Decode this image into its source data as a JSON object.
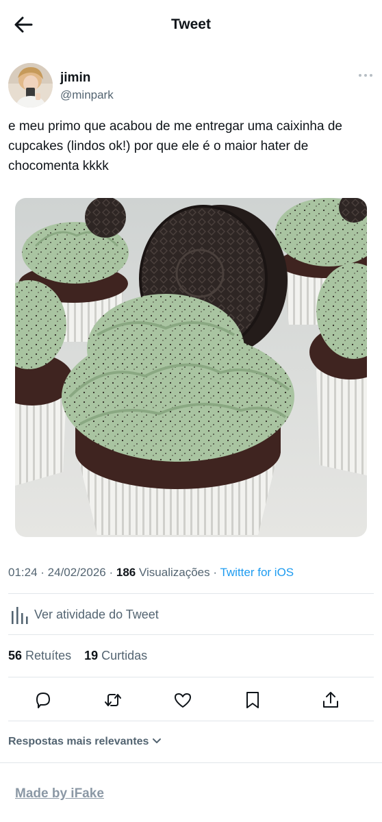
{
  "header": {
    "title": "Tweet",
    "back_icon": "arrow-left-icon"
  },
  "tweet": {
    "author": {
      "name": "jimin",
      "handle": "@minpark"
    },
    "text": "e meu primo que acabou de me entregar uma caixinha de cupcakes (lindos ok!) por que ele é o maior hater de chocomenta kkkk",
    "image_subject": "mint chocolate cupcakes with oreo cookies",
    "meta": {
      "time": "01:24",
      "date": "24/02/2026",
      "views_count": "186",
      "views_label": "Visualizações",
      "source": "Twitter for iOS"
    },
    "activity_label": "Ver atividade do Tweet",
    "stats": {
      "retweets_count": "56",
      "retweets_label": "Retuítes",
      "likes_count": "19",
      "likes_label": "Curtidas"
    },
    "actions": [
      "reply-icon",
      "retweet-icon",
      "like-icon",
      "bookmark-icon",
      "share-icon"
    ]
  },
  "replies": {
    "sort_label": "Respostas mais relevantes"
  },
  "footer": {
    "watermark": "Made by iFake"
  },
  "colors": {
    "text": "#0f1419",
    "secondary": "#536471",
    "link": "#1d9bf0",
    "frosting": "#a9c4a1",
    "cake": "#3f2420"
  }
}
